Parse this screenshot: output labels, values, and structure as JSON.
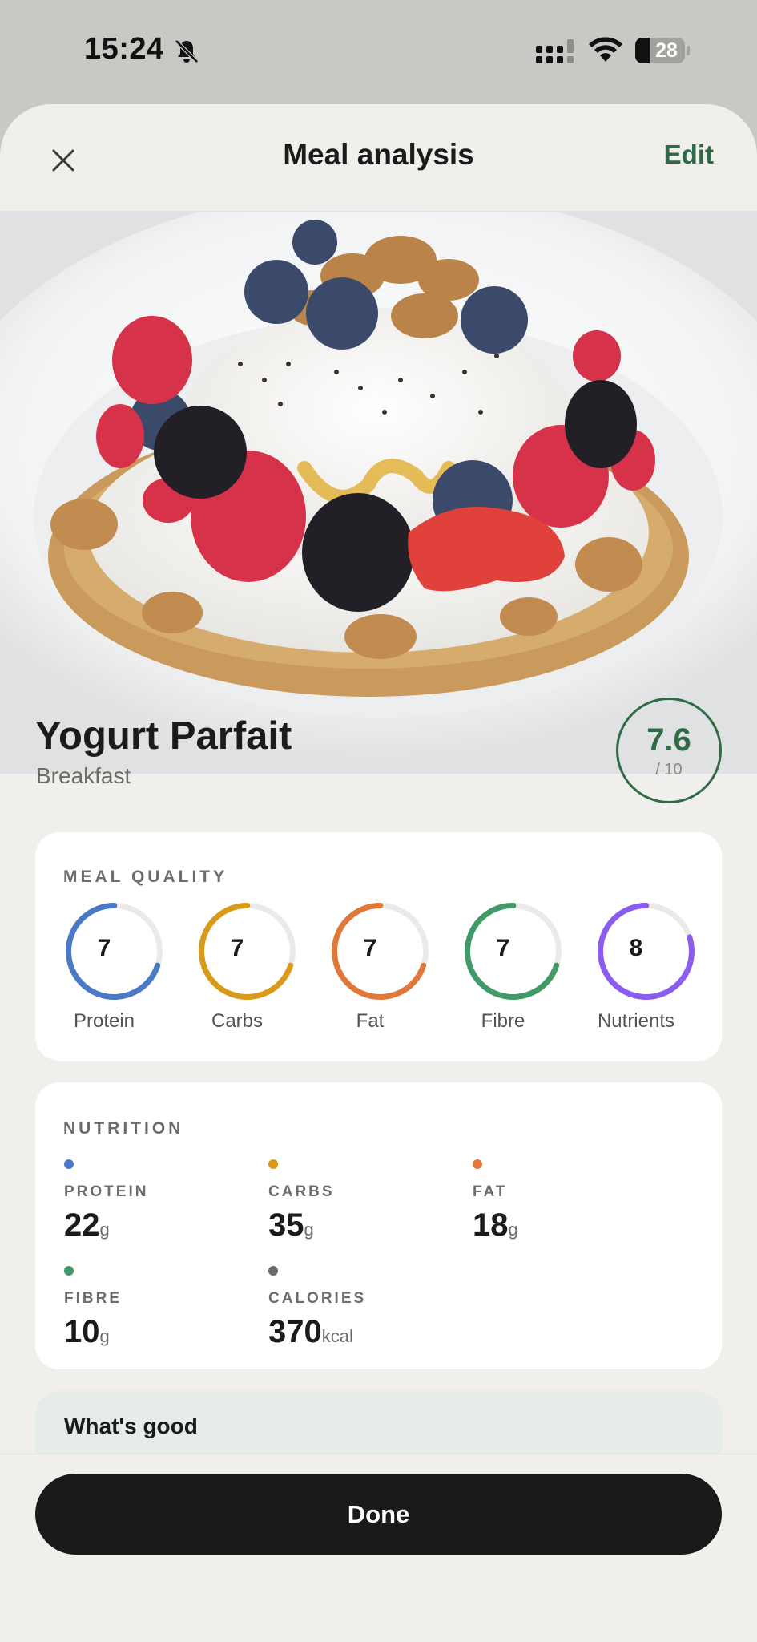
{
  "status_bar": {
    "time": "15:24",
    "battery": "28",
    "icons": [
      "bell-off-icon",
      "cellular-signal-icon",
      "wifi-icon",
      "battery-icon"
    ]
  },
  "nav": {
    "title": "Meal analysis",
    "edit_label": "Edit",
    "close_icon": "close-icon"
  },
  "meal": {
    "name": "Yogurt Parfait",
    "type": "Breakfast",
    "score": "7.6",
    "score_max": "/ 10",
    "accent_color": "#2f6b45"
  },
  "quality": {
    "label": "MEAL QUALITY",
    "items": [
      {
        "label": "Protein",
        "score": "7",
        "fraction": 0.7,
        "color": "#4a7ac6"
      },
      {
        "label": "Carbs",
        "score": "7",
        "fraction": 0.7,
        "color": "#d99a1a"
      },
      {
        "label": "Fat",
        "score": "7",
        "fraction": 0.7,
        "color": "#e0783a"
      },
      {
        "label": "Fibre",
        "score": "7",
        "fraction": 0.7,
        "color": "#3f9a68"
      },
      {
        "label": "Nutrients",
        "score": "8",
        "fraction": 0.8,
        "color": "#8b5cf0"
      }
    ]
  },
  "nutrition": {
    "label": "NUTRITION",
    "items": [
      {
        "label": "PROTEIN",
        "value": "22",
        "unit": "g",
        "color": "#4a7ac6"
      },
      {
        "label": "CARBS",
        "value": "35",
        "unit": "g",
        "color": "#d99a1a"
      },
      {
        "label": "FAT",
        "value": "18",
        "unit": "g",
        "color": "#e0783a"
      },
      {
        "label": "FIBRE",
        "value": "10",
        "unit": "g",
        "color": "#3f9a68"
      },
      {
        "label": "CALORIES",
        "value": "370",
        "unit": "kcal",
        "color": "#6b6b6b"
      }
    ]
  },
  "whats_good": {
    "title": "What's good"
  },
  "footer": {
    "done_label": "Done"
  }
}
